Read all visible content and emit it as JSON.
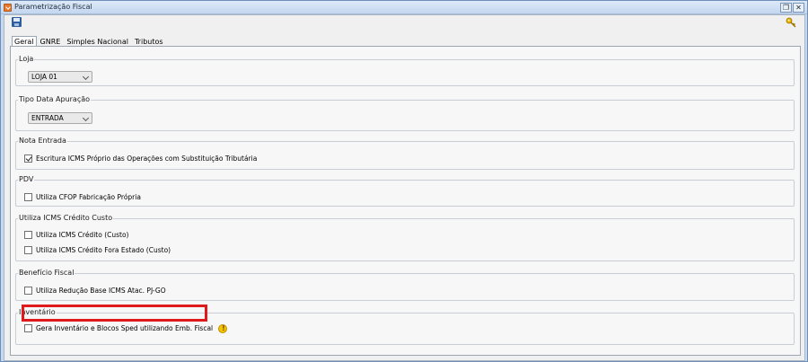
{
  "window": {
    "title": "Parametrização Fiscal"
  },
  "tabs": [
    "Geral",
    "GNRE",
    "Simples Nacional",
    "Tributos"
  ],
  "groups": {
    "loja": {
      "title": "Loja",
      "select_value": "LOJA 01"
    },
    "tipo_data": {
      "title": "Tipo Data Apuração",
      "select_value": "ENTRADA"
    },
    "nota_entrada": {
      "title": "Nota Entrada",
      "checkbox_label": "Escritura ICMS Próprio das Operações com Substituição Tributária",
      "checked": true
    },
    "pdv": {
      "title": "PDV",
      "checkbox_label": "Utiliza CFOP Fabricação Própria",
      "checked": false
    },
    "icms_credito": {
      "title": "Utiliza ICMS Crédito Custo",
      "items": [
        {
          "label": "Utiliza ICMS Crédito (Custo)",
          "checked": false
        },
        {
          "label": "Utiliza ICMS Crédito Fora Estado (Custo)",
          "checked": false
        }
      ]
    },
    "beneficio": {
      "title": "Benefício Fiscal",
      "checkbox_label": "Utiliza Redução Base ICMS Atac. PJ-GO",
      "checked": false
    },
    "inventario": {
      "title": "Inventário",
      "checkbox_label": "Gera Inventário e Blocos Sped utilizando Emb. Fiscal",
      "checked": false
    }
  },
  "icons": {
    "app": "app-icon",
    "save": "save-icon",
    "key": "key-icon",
    "warning": "warning-icon"
  },
  "colors": {
    "highlight": "#e0191c",
    "warning": "#f5c400"
  }
}
